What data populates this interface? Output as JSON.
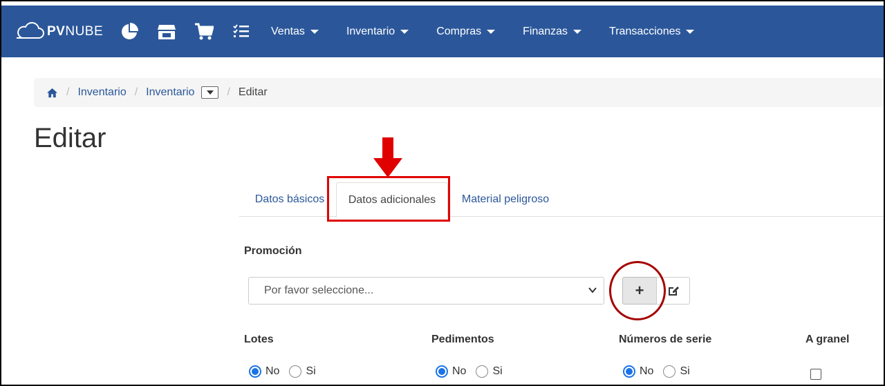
{
  "navbar": {
    "brand_bold": "PV",
    "brand_thin": "NUBE",
    "icons": [
      "pie-chart-icon",
      "store-icon",
      "cart-icon",
      "tasks-icon"
    ],
    "menu": [
      {
        "label": "Ventas"
      },
      {
        "label": "Inventario"
      },
      {
        "label": "Compras"
      },
      {
        "label": "Finanzas"
      },
      {
        "label": "Transacciones"
      }
    ],
    "color": "#2b579a"
  },
  "breadcrumb": {
    "items": [
      "Inventario",
      "Inventario",
      "Editar"
    ]
  },
  "page": {
    "title": "Editar"
  },
  "tabs": [
    {
      "label": "Datos básicos",
      "active": false
    },
    {
      "label": "Datos adicionales",
      "active": true
    },
    {
      "label": "Material peligroso",
      "active": false
    }
  ],
  "promocion": {
    "label": "Promoción",
    "select_value": "Por favor seleccione...",
    "add_label": "+"
  },
  "options": {
    "lotes": {
      "label": "Lotes",
      "no": "No",
      "si": "Si",
      "selected": "No"
    },
    "pedimentos": {
      "label": "Pedimentos",
      "no": "No",
      "si": "Si",
      "selected": "No"
    },
    "numeros_serie": {
      "label": "Números de serie",
      "no": "No",
      "si": "Si",
      "selected": "No"
    },
    "a_granel": {
      "label": "A granel",
      "checked": false
    }
  },
  "annotation_color": "#e00000"
}
